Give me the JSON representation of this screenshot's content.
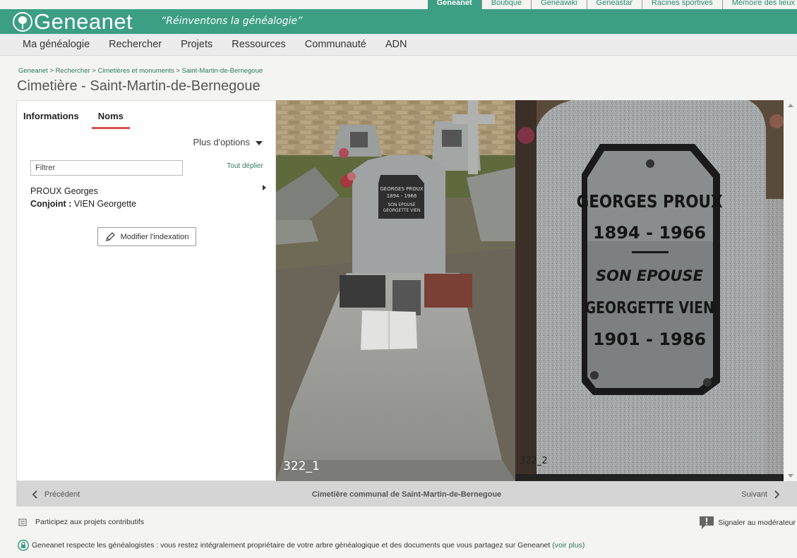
{
  "top_links": [
    {
      "label": "Geneanet",
      "active": true
    },
    {
      "label": "Boutique"
    },
    {
      "label": "Geneawiki"
    },
    {
      "label": "Geneastar"
    },
    {
      "label": "Racines sportives"
    },
    {
      "label": "Mémoire des lieux"
    }
  ],
  "brand": {
    "name": "Geneanet",
    "tagline": "“Réinventons la généalogie”"
  },
  "main_nav": [
    "Ma généalogie",
    "Rechercher",
    "Projets",
    "Ressources",
    "Communauté",
    "ADN"
  ],
  "breadcrumb": [
    "Geneanet",
    "Rechercher",
    "Cimetières et monuments",
    "Saint-Martin-de-Bernegoue"
  ],
  "page_title": "Cimetière - Saint-Martin-de-Bernegoue",
  "panel": {
    "tabs": [
      {
        "label": "Informations",
        "active": false
      },
      {
        "label": "Noms",
        "active": true
      }
    ],
    "more_options": "Plus d'options",
    "filter_placeholder": "Filtrer",
    "expand_all": "Tout déplier",
    "person_name": "PROUX Georges",
    "spouse_label": "Conjoint :",
    "spouse_name": "VIEN Georgette",
    "edit_button": "Modifier l'indexation"
  },
  "photos": {
    "photo1_caption": "322_1",
    "photo2_caption": "322_2",
    "plaque_line1": "GEORGES PROUX",
    "plaque_line2": "1894 - 1966",
    "plaque_line3": "SON EPOUSE",
    "plaque_line4": "GEORGETTE VIEN",
    "plaque_line5": "1901 - 1986"
  },
  "pager": {
    "prev": "Précédent",
    "center": "Cimetière communal de Saint-Martin-de-Bernegoue",
    "next": "Suivant"
  },
  "contrib": "Participez aux projets contributifs",
  "report": "Signaler au modérateur",
  "footer_note": "Geneanet respecte les généalogistes : vous restez intégralement propriétaire de votre arbre généalogique et des documents que vous partagez sur Geneanet",
  "footer_link": "(voir plus)",
  "colors": {
    "brand_green": "#3c9e83",
    "link_green": "#2d7b62",
    "tab_underline": "#d9534f"
  }
}
